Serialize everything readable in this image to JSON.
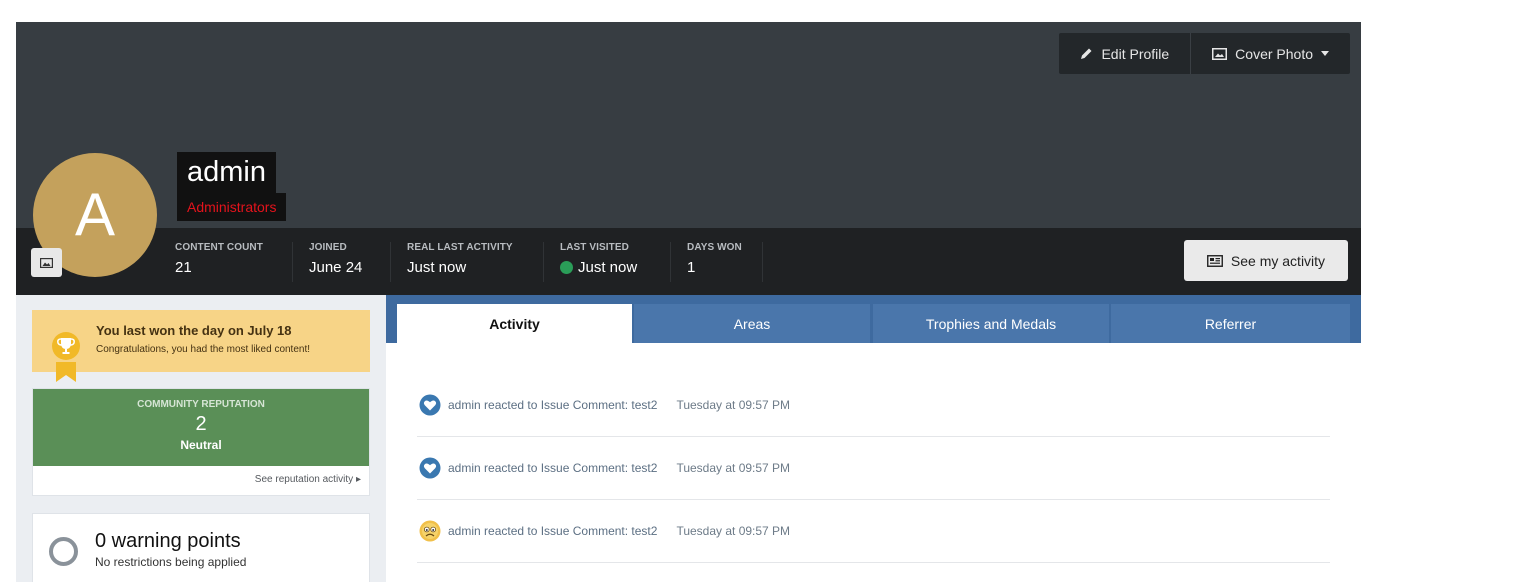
{
  "cover": {
    "edit_profile_label": "Edit Profile",
    "cover_photo_label": "Cover Photo"
  },
  "profile": {
    "avatar_letter": "A",
    "username": "admin",
    "group": "Administrators",
    "avatar_color": "#c4a15c",
    "group_color": "#e4131c"
  },
  "stats": [
    {
      "label": "CONTENT COUNT",
      "value": "21"
    },
    {
      "label": "JOINED",
      "value": "June 24"
    },
    {
      "label": "REAL LAST ACTIVITY",
      "value": "Just now"
    },
    {
      "label": "LAST VISITED",
      "value": "Just now"
    },
    {
      "label": "DAYS WON",
      "value": "1"
    }
  ],
  "see_activity_label": "See my activity",
  "days_won": {
    "title": "You last won the day on July 18",
    "subtitle": "Congratulations, you had the most liked content!"
  },
  "reputation": {
    "label": "COMMUNITY REPUTATION",
    "value": "2",
    "status": "Neutral",
    "link": "See reputation activity"
  },
  "warnings": {
    "title": "0 warning points",
    "subtitle": "No restrictions being applied"
  },
  "tabs": [
    {
      "label": "Activity",
      "active": true
    },
    {
      "label": "Areas",
      "active": false
    },
    {
      "label": "Trophies and Medals",
      "active": false
    },
    {
      "label": "Referrer",
      "active": false
    }
  ],
  "activity": [
    {
      "icon": "heart-reaction-icon",
      "text": "admin reacted to Issue Comment: test2",
      "time": "Tuesday at 09:57 PM"
    },
    {
      "icon": "heart-reaction-icon",
      "text": "admin reacted to Issue Comment: test2",
      "time": "Tuesday at 09:57 PM"
    },
    {
      "icon": "sad-reaction-icon",
      "text": "admin reacted to Issue Comment: test2",
      "time": "Tuesday at 09:57 PM"
    }
  ]
}
